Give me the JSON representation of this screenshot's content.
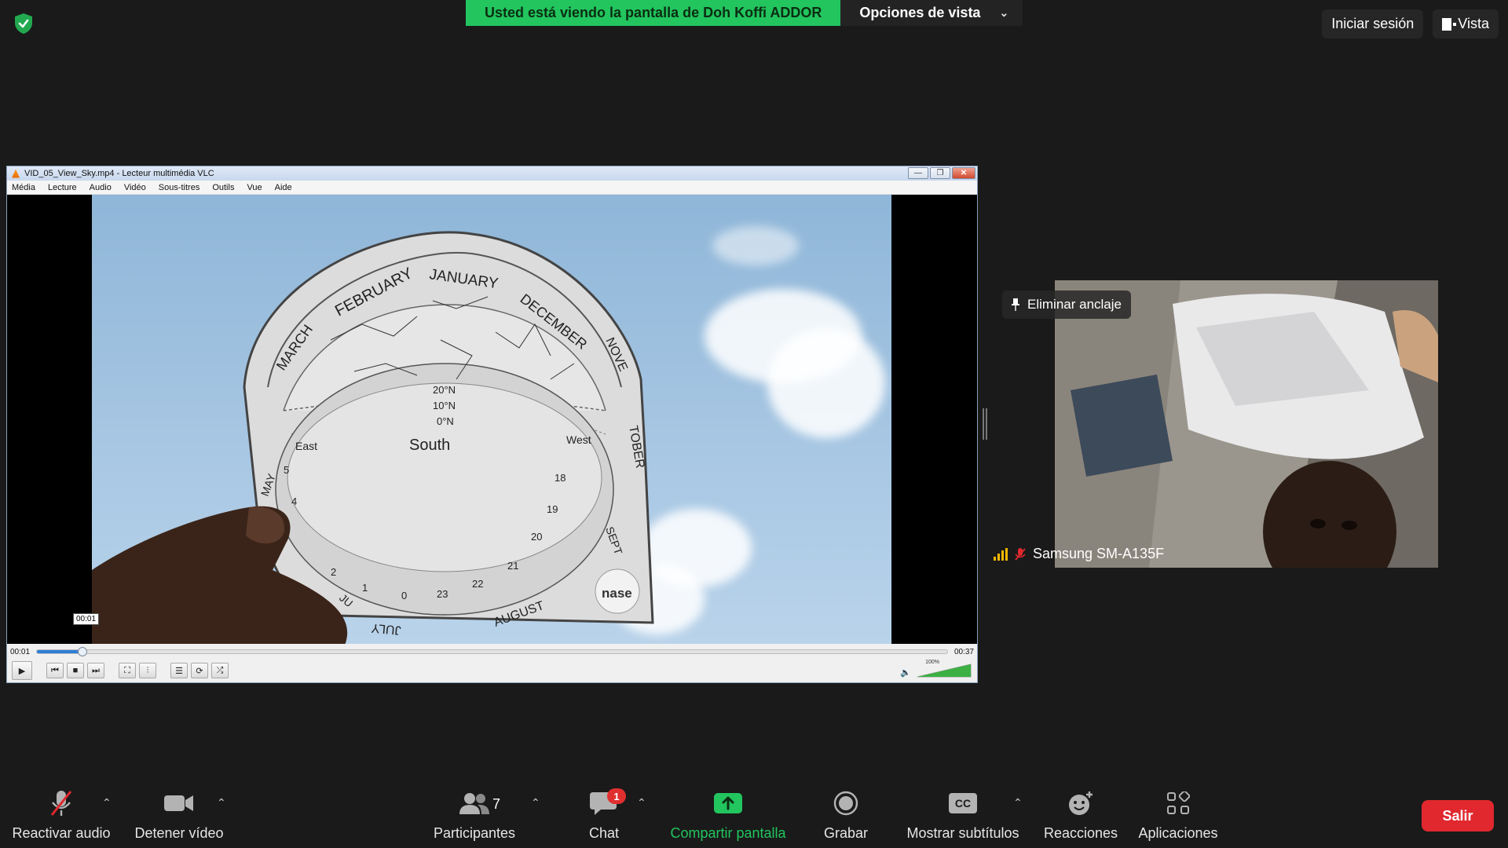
{
  "banner": {
    "viewing_text": "Usted está viendo la pantalla de Doh Koffi ADDOR",
    "view_options_label": "Opciones de vista",
    "view_options_icon": "chevron-down-icon"
  },
  "top_right": {
    "sign_in": "Iniciar sesión",
    "view": "Vista"
  },
  "vlc": {
    "title": "VID_05_View_Sky.mp4 - Lecteur multimédia VLC",
    "menu": [
      "Média",
      "Lecture",
      "Audio",
      "Vidéo",
      "Sous-titres",
      "Outils",
      "Vue",
      "Aide"
    ],
    "time_elapsed": "00:01",
    "time_total": "00:37",
    "hover_time": "00:01",
    "progress_fraction": 0.05,
    "volume": "100%",
    "volume_fraction": 1.0
  },
  "video_content": {
    "months": [
      "FEBRUARY",
      "JANUARY",
      "DECEMBER",
      "MARCH",
      "NOVE",
      "TOBER",
      "MAY",
      "SEPT",
      "JU",
      "JULY",
      "AUGUST"
    ],
    "latitudes": [
      "20°N",
      "10°N",
      "0°N"
    ],
    "directions": {
      "south": "South",
      "east": "East",
      "west": "West"
    },
    "hour_numbers": [
      "2",
      "1",
      "0",
      "23",
      "22",
      "21",
      "20",
      "19",
      "18",
      "5",
      "4"
    ],
    "logo_text": "nase"
  },
  "participant": {
    "pin_label": "Eliminar anclaje",
    "name": "Samsung SM-A135F"
  },
  "toolbar": {
    "audio": "Reactivar audio",
    "video": "Detener vídeo",
    "participants": "Participantes",
    "participants_count": "7",
    "chat": "Chat",
    "chat_badge": "1",
    "share": "Compartir pantalla",
    "record": "Grabar",
    "captions": "Mostrar subtítulos",
    "captions_icon_text": "CC",
    "reactions": "Reacciones",
    "apps": "Aplicaciones",
    "leave": "Salir"
  },
  "colors": {
    "share_green": "#22c55e",
    "leave_red": "#e0282e",
    "badge_red": "#e02f2f",
    "background": "#1a1a1a"
  }
}
